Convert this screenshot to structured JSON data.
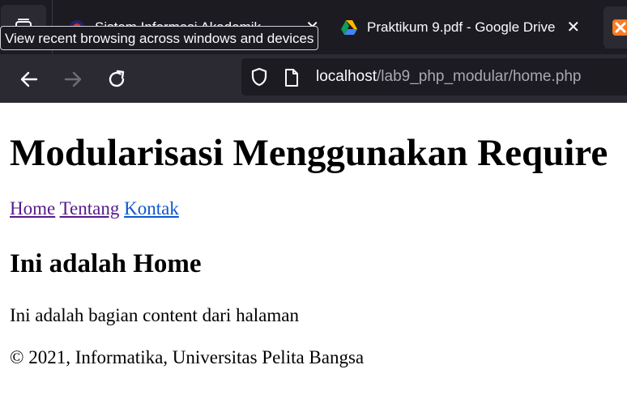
{
  "browser": {
    "tabs": [
      {
        "title": "Sistem Informasi Akademik",
        "close": "✕",
        "icon": "academic-favicon-icon"
      },
      {
        "title": "Praktikum 9.pdf - Google Drive",
        "close": "✕",
        "icon": "google-drive-icon"
      },
      {
        "title": "",
        "icon": "xampp-icon"
      }
    ],
    "tooltip": "View recent browsing across windows and devices",
    "url": {
      "host": "localhost",
      "path": "/lab9_php_modular/home.php"
    },
    "icons": {
      "overview": "tab-overview-icon",
      "back": "back-arrow-icon",
      "forward": "forward-arrow-icon",
      "reload": "reload-icon",
      "shield": "tracking-protection-shield-icon",
      "page": "page-info-icon"
    }
  },
  "page": {
    "title": "Modularisasi Menggunakan Require",
    "nav": [
      "Home",
      "Tentang",
      "Kontak"
    ],
    "heading": "Ini adalah Home",
    "content": "Ini adalah bagian content dari halaman",
    "footer": "© 2021, Informatika, Universitas Pelita Bangsa"
  },
  "colors": {
    "chrome_dark": "#1c1b22",
    "chrome_mid": "#2b2a33",
    "link_visited": "#551a8b",
    "link_unvisited": "#0b57d0"
  }
}
